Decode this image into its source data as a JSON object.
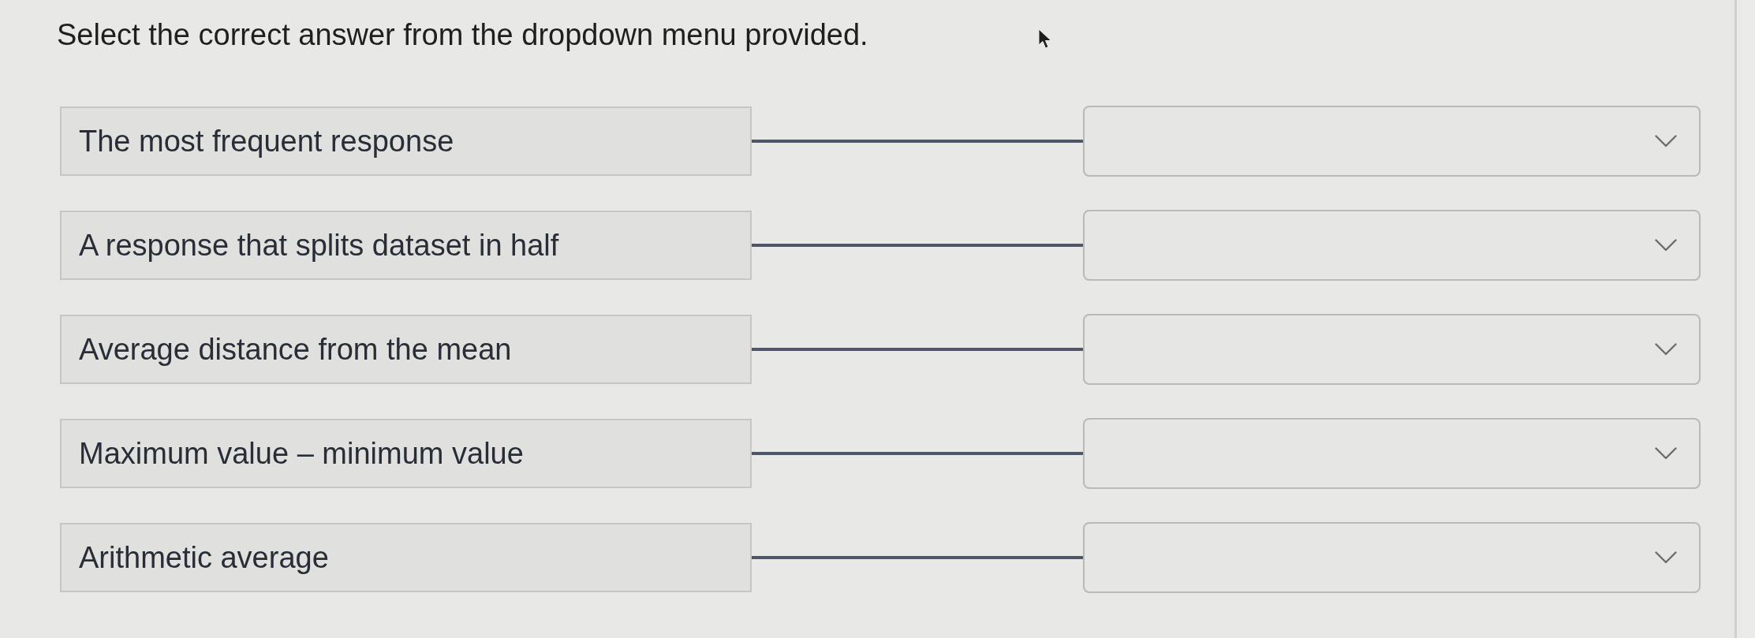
{
  "instruction": "Select the correct answer from the dropdown menu provided.",
  "pairs": [
    {
      "term": "The most frequent response"
    },
    {
      "term": "A response that splits dataset in half"
    },
    {
      "term": "Average distance from the mean"
    },
    {
      "term": "Maximum value – minimum value"
    },
    {
      "term": "Arithmetic average"
    }
  ]
}
